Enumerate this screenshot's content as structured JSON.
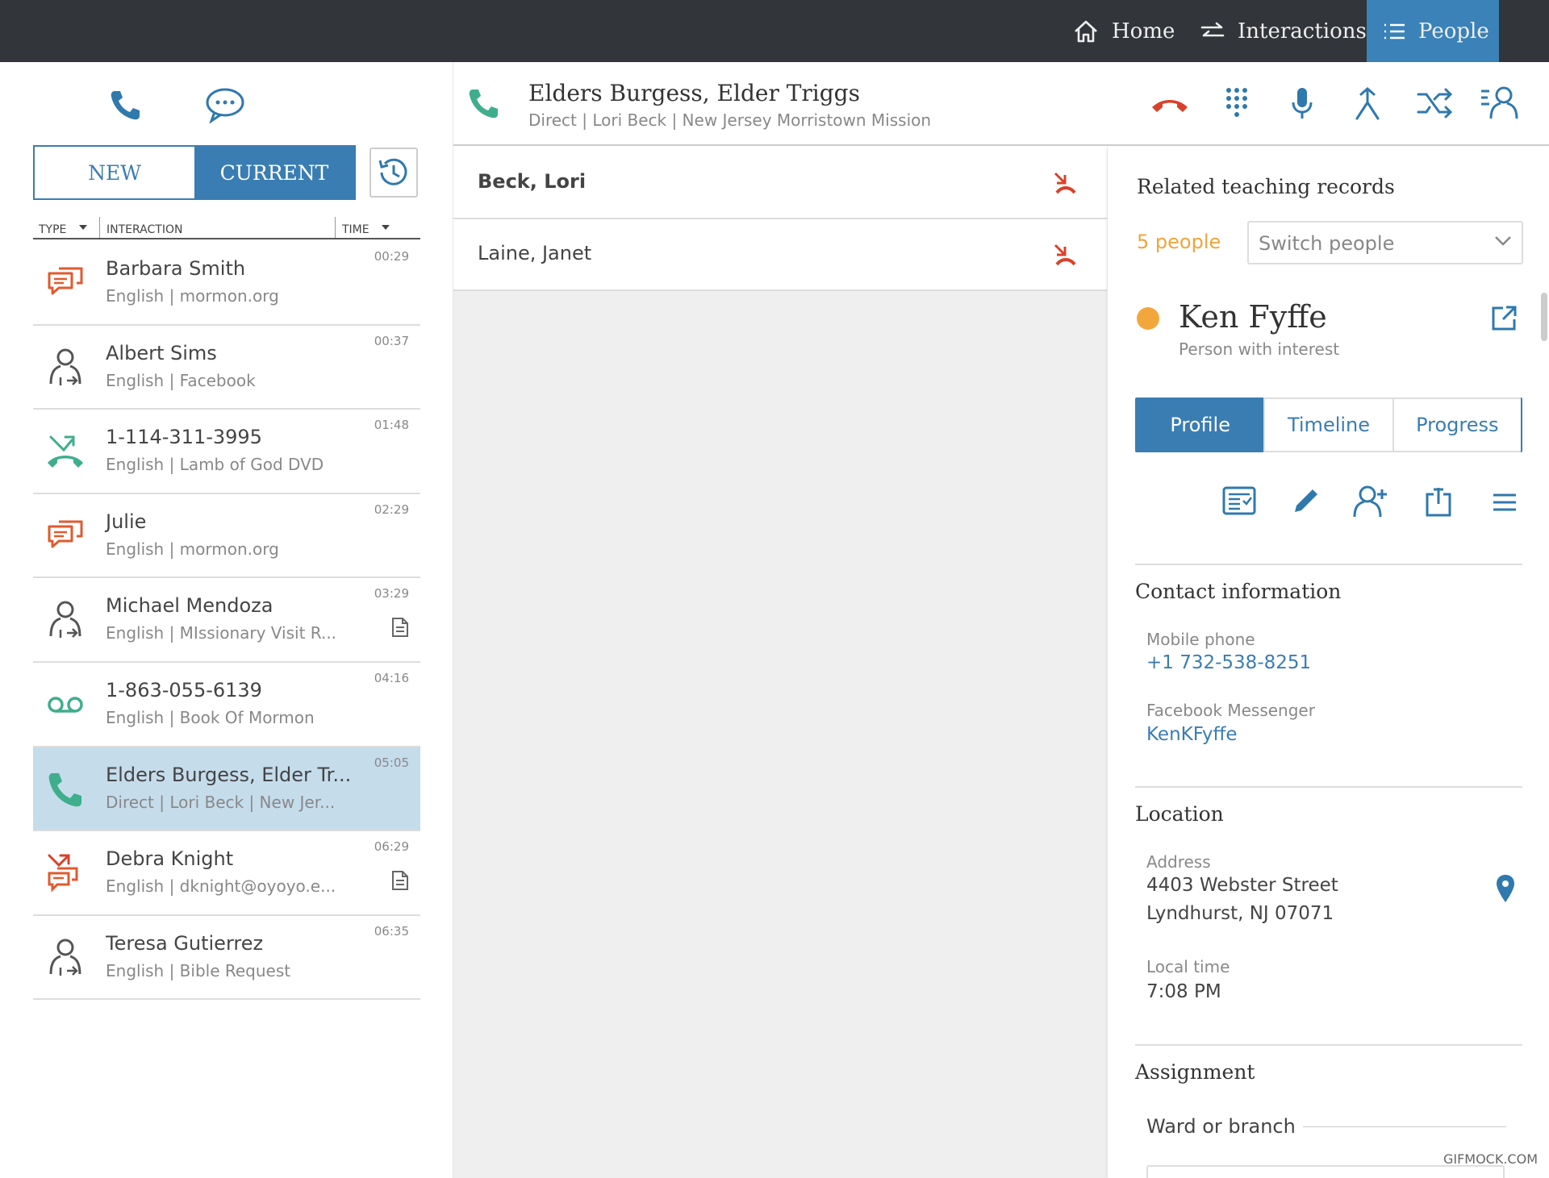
{
  "nav": {
    "home": "Home",
    "interactions": "Interactions",
    "people": "People"
  },
  "left": {
    "tab_new": "NEW",
    "tab_current": "CURRENT",
    "columns": {
      "type": "TYPE",
      "interaction": "INTERACTION",
      "time": "TIME"
    },
    "rows": [
      {
        "name": "Barbara Smith",
        "sub": "English | mormon.org",
        "time": "00:29",
        "icon": "chat-icon"
      },
      {
        "name": "Albert Sims",
        "sub": "English | Facebook",
        "time": "00:37",
        "icon": "person-referral-icon"
      },
      {
        "name": "1-114-311-3995",
        "sub": "English | Lamb of God DVD",
        "time": "01:48",
        "icon": "missed-call-icon"
      },
      {
        "name": "Julie",
        "sub": "English | mormon.org",
        "time": "02:29",
        "icon": "chat-icon"
      },
      {
        "name": "Michael Mendoza",
        "sub": "English | MIssionary Visit R...",
        "time": "03:29",
        "icon": "person-referral-icon"
      },
      {
        "name": "1-863-055-6139",
        "sub": "English | Book Of Mormon",
        "time": "04:16",
        "icon": "voicemail-icon"
      },
      {
        "name": "Elders Burgess, Elder Tr...",
        "sub": "Direct | Lori Beck | New Jer...",
        "time": "05:05",
        "icon": "phone-icon"
      },
      {
        "name": "Debra Knight",
        "sub": "English | dknight@oyoyo.e...",
        "time": "06:29",
        "icon": "missed-chat-icon"
      },
      {
        "name": "Teresa Gutierrez",
        "sub": "English | Bible Request",
        "time": "06:35",
        "icon": "person-referral-icon"
      }
    ]
  },
  "call": {
    "title": "Elders Burgess, Elder Triggs",
    "sub": "Direct | Lori Beck | New Jersey Morristown Mission",
    "participants": [
      {
        "name": "Beck, Lori"
      },
      {
        "name": "Laine, Janet"
      }
    ]
  },
  "related": {
    "title": "Related teaching records",
    "count": "5 people",
    "switch_placeholder": "Switch people",
    "person_name": "Ken Fyffe",
    "person_type": "Person with interest",
    "tabs": [
      "Profile",
      "Timeline",
      "Progress"
    ],
    "contact_title": "Contact information",
    "mobile_label": "Mobile phone",
    "mobile_value": "+1 732-538-8251",
    "fb_label": "Facebook Messenger",
    "fb_value": "KenKFyffe",
    "location_title": "Location",
    "address_label": "Address",
    "address_line1": "4403 Webster Street",
    "address_line2": "Lyndhurst, NJ 07071",
    "localtime_label": "Local time",
    "localtime_value": "7:08 PM",
    "assignment_title": "Assignment",
    "ward_label": "Ward or branch"
  },
  "watermark": "GIFMOCK.COM",
  "colors": {
    "accent": "#3a7db3",
    "topbar": "#323539",
    "orange": "#f0a43c",
    "red": "#d9412b",
    "green": "#3fae8c",
    "selected_row": "#c5dceb"
  }
}
